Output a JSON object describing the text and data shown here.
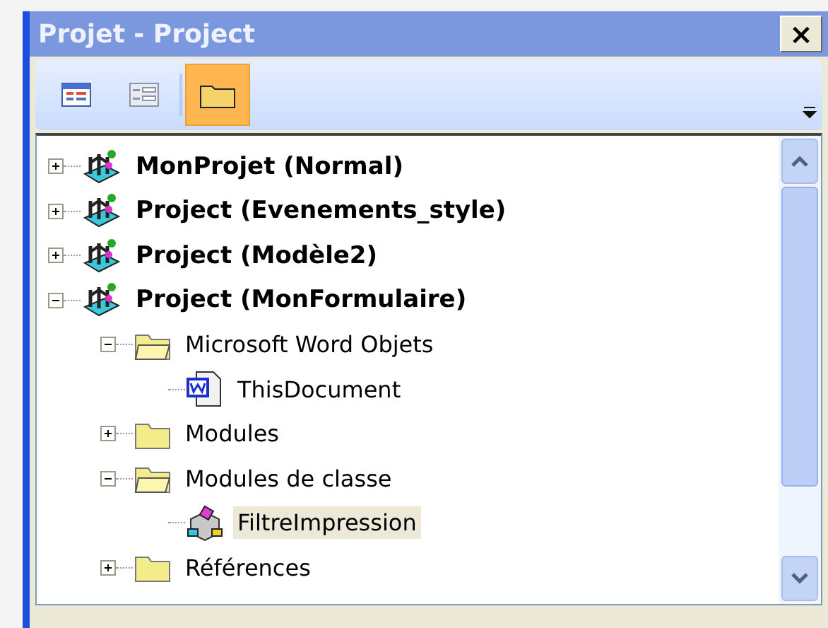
{
  "window": {
    "title": "Projet - Project",
    "close": "×"
  },
  "toolbar": [
    {
      "kind": "code",
      "selected": false
    },
    {
      "kind": "form",
      "selected": false
    },
    {
      "kind": "folders",
      "selected": true
    }
  ],
  "tree": [
    {
      "label": "MonProjet (Normal)",
      "kind": "project",
      "expanded": false,
      "selected": false
    },
    {
      "label": "Project (Evenements_style)",
      "kind": "project",
      "expanded": false,
      "selected": false
    },
    {
      "label": "Project (Modèle2)",
      "kind": "project",
      "expanded": false,
      "selected": false
    },
    {
      "label": "Project (MonFormulaire)",
      "kind": "project",
      "expanded": true,
      "selected": false,
      "children": [
        {
          "label": "Microsoft Word Objets",
          "kind": "folder",
          "expanded": true,
          "selected": false,
          "children": [
            {
              "label": "ThisDocument",
              "kind": "document",
              "selected": false
            }
          ]
        },
        {
          "label": "Modules",
          "kind": "folder",
          "expanded": false,
          "selected": false
        },
        {
          "label": "Modules de classe",
          "kind": "folder",
          "expanded": true,
          "selected": false,
          "children": [
            {
              "label": "FiltreImpression",
              "kind": "class",
              "selected": true
            }
          ]
        },
        {
          "label": "Références",
          "kind": "folder",
          "expanded": false,
          "selected": false
        }
      ]
    }
  ]
}
